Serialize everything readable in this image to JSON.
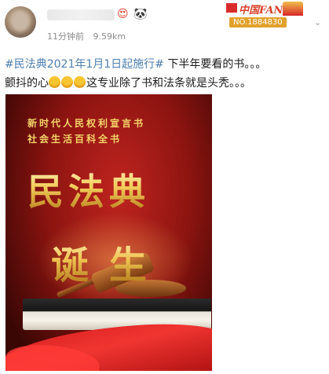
{
  "header": {
    "avatar_icon": "avatar",
    "emoji_1": "😍",
    "emoji_2": "🐼",
    "time": "11分钟前",
    "views": "9.59km"
  },
  "fans_badge": {
    "brand": "中国FANS",
    "number": "NO.1884830"
  },
  "post": {
    "hashtag": "#民法典2021年1月1日起施行#",
    "line1_rest": " 下半年要看的书。。。",
    "line2_start": "颤抖的心",
    "line2_end": "这专业除了书和法条就是头秃。。。"
  },
  "poster": {
    "subtitle_1": "新时代人民权利宣言书",
    "subtitle_2": "社会生活百科全书",
    "title_1": "民法典",
    "title_2": "诞生"
  },
  "colors": {
    "tag_blue": "#4d7fb0",
    "poster_red": "#8c1410",
    "gold": "#f2cd5b"
  }
}
